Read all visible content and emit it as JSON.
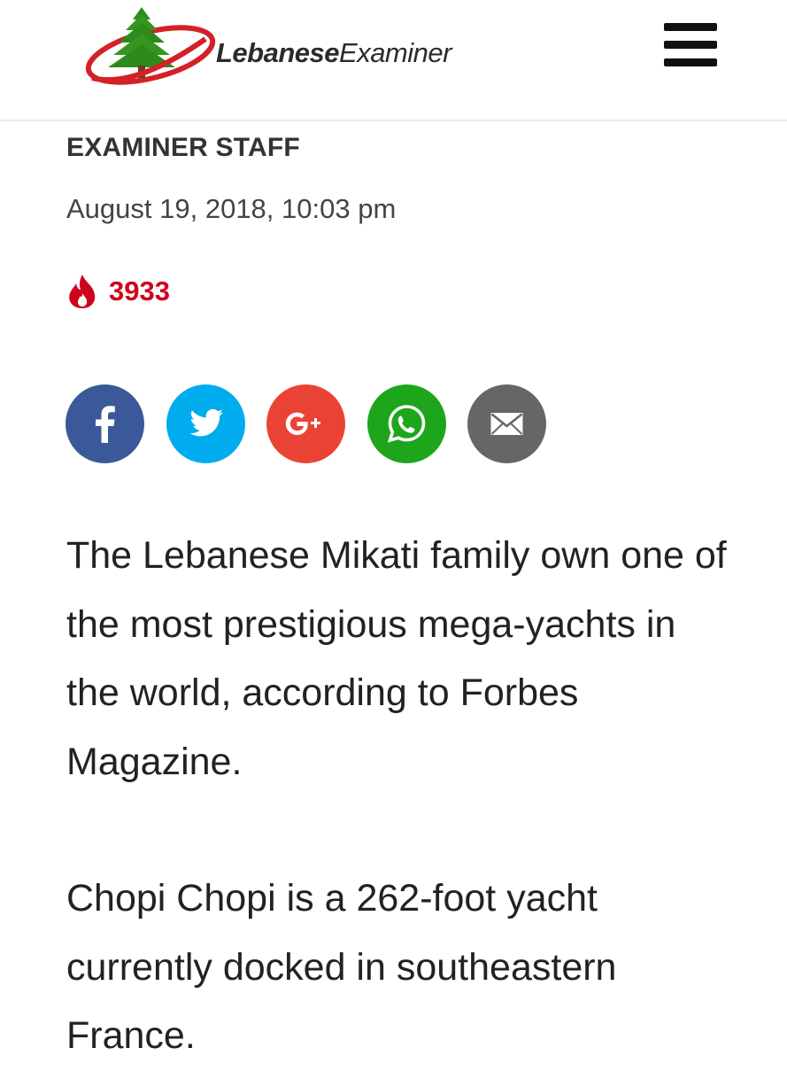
{
  "header": {
    "logo_text_strong": "Lebanese",
    "logo_text_rest": "Examiner",
    "menu_icon": "hamburger-menu-icon"
  },
  "article": {
    "author": "EXAMINER STAFF",
    "date": "August 19, 2018, 10:03 pm",
    "views_icon": "flame-icon",
    "views": "3933",
    "paragraphs": [
      "The Lebanese Mikati family own one of the most prestigious mega-yachts in the world, according to Forbes Magazine.",
      "Chopi Chopi is a 262-foot yacht currently docked in southeastern France."
    ]
  },
  "share": [
    {
      "name": "facebook",
      "icon": "facebook-icon",
      "color": "#3b5998"
    },
    {
      "name": "twitter",
      "icon": "twitter-icon",
      "color": "#00aced"
    },
    {
      "name": "google-plus",
      "icon": "google-plus-icon",
      "color": "#ea4335"
    },
    {
      "name": "whatsapp",
      "icon": "whatsapp-icon",
      "color": "#1da51c"
    },
    {
      "name": "email",
      "icon": "email-icon",
      "color": "#666666"
    }
  ],
  "colors": {
    "accent_red": "#d0021b",
    "logo_green": "#2f8a1c",
    "logo_red": "#d42027"
  }
}
